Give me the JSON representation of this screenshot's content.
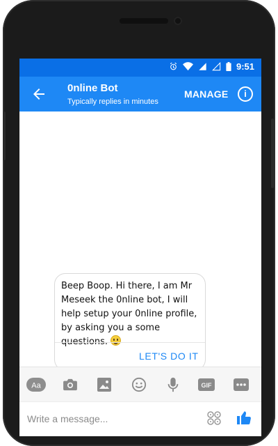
{
  "status_bar": {
    "time": "9:51"
  },
  "header": {
    "title": "0nline Bot",
    "subtitle": "Typically replies in minutes",
    "manage_label": "MANAGE"
  },
  "chat": {
    "message_text": "Beep Boop. Hi there, I am Mr Meseek the 0nline bot, I will help setup your 0nline profile, by asking you a some questions.",
    "cta_label": "LET'S DO IT"
  },
  "composer": {
    "placeholder": "Write a message...",
    "tools": [
      "text-format-icon",
      "camera-icon",
      "image-icon",
      "emoji-icon",
      "microphone-icon",
      "gif-icon",
      "more-icon"
    ],
    "text_tool_label": "Aa",
    "gif_label": "GIF"
  },
  "colors": {
    "status_bar": "#0a6fe6",
    "app_bar": "#1e88f5",
    "accent": "#1e88f5"
  }
}
